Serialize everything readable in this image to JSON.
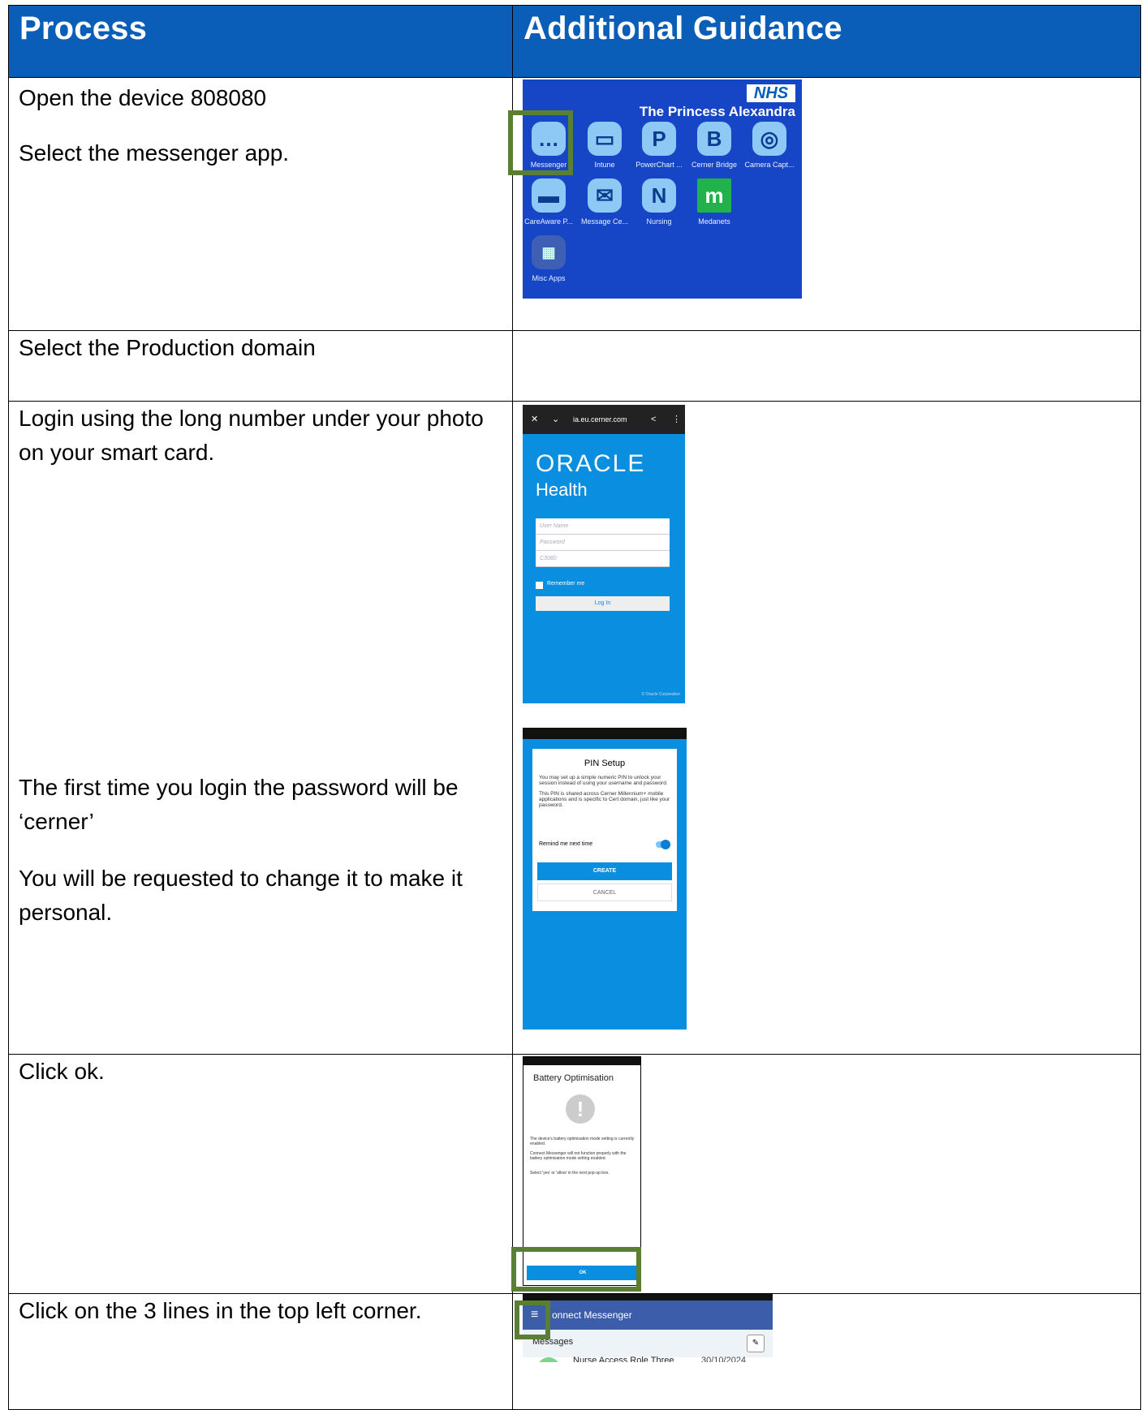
{
  "header": {
    "process": "Process",
    "guidance": "Additional Guidance"
  },
  "rows": [
    {
      "text": [
        "Open the device 808080",
        "Select the messenger app."
      ]
    },
    {
      "text": [
        "Select the Production domain"
      ]
    },
    {
      "text": [
        "Login using the long number under your photo on your smart card."
      ],
      "text2": [
        "The first time you login the password will be ‘cerner’",
        "You will be requested to change it to make it personal."
      ]
    },
    {
      "text": [
        "Click ok."
      ]
    },
    {
      "text": [
        "Click on the 3 lines in the top left corner."
      ]
    }
  ],
  "apps_screen": {
    "nhs": "NHS",
    "trust": "The Princess Alexandra",
    "apps": [
      {
        "label": "Messenger",
        "glyph": "…"
      },
      {
        "label": "Intune",
        "glyph": "▭"
      },
      {
        "label": "PowerChart ...",
        "glyph": "P"
      },
      {
        "label": "Cerner Bridge",
        "glyph": "B"
      },
      {
        "label": "Camera Capt...",
        "glyph": "◎"
      },
      {
        "label": "CareAware P...",
        "glyph": "▬"
      },
      {
        "label": "Message Ce...",
        "glyph": "✉"
      },
      {
        "label": "Nursing",
        "glyph": "N"
      },
      {
        "label": "Medanets",
        "glyph": "m"
      },
      {
        "label": "Misc Apps",
        "glyph": "▦"
      }
    ]
  },
  "login_screen": {
    "url": "ia.eu.cerner.com",
    "brand": "ORACLE",
    "brand_sub": "Health",
    "fields": [
      "User Name",
      "Password",
      "C3080"
    ],
    "remember": "Remember me",
    "login": "Log In",
    "footer": "© Oracle Corporation"
  },
  "pin_screen": {
    "title": "PIN Setup",
    "para1": "You may set up a simple numeric PIN to unlock your session instead of using your username and password.",
    "para2": "This PIN is shared across Cerner Millennium+ mobile applications and is specific to Cert domain, just like your password.",
    "remind": "Remind me next time",
    "create": "CREATE",
    "cancel": "CANCEL"
  },
  "battery_screen": {
    "title": "Battery Optimisation",
    "p1": "The device's battery optimisation mode setting is currently enabled.",
    "p2": "Connect Messenger will not function properly with the battery optimisation mode setting enabled.",
    "p3": "Select 'yes' or 'allow' in the next pop-up box.",
    "ok": "OK"
  },
  "messenger_screen": {
    "title": "onnect Messenger",
    "section": "Messages",
    "contact": "Nurse Access Role Three",
    "date": "30/10/2024"
  },
  "colors": {
    "header_blue": "#0a5eb7",
    "highlight_green": "#5a7e33"
  }
}
